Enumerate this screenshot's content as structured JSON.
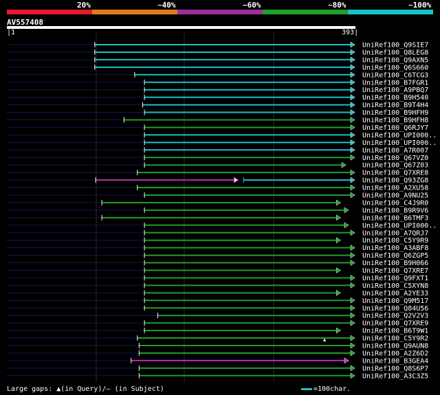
{
  "legend": {
    "labels": [
      "20%",
      "~40%",
      "~60%",
      "~80%",
      "~100%"
    ],
    "colors": [
      "#e8192c",
      "#e07a1a",
      "#9b2f9b",
      "#1f9e2a",
      "#19c1c9"
    ]
  },
  "query": {
    "title": "AV557408",
    "start": "1",
    "end": "393"
  },
  "hits": [
    {
      "label": "UniRef100_Q9SIE7",
      "start": 100,
      "end": 393,
      "color": "cyan",
      "cap": "arrow"
    },
    {
      "label": "UniRef100_Q8LEG8",
      "start": 100,
      "end": 393,
      "color": "cyan",
      "cap": "arrow"
    },
    {
      "label": "UniRef100_Q9AXN5",
      "start": 100,
      "end": 393,
      "color": "cyan",
      "cap": "arrow"
    },
    {
      "label": "UniRef100_Q6S660",
      "start": 100,
      "end": 393,
      "color": "cyan",
      "cap": "arrow"
    },
    {
      "label": "UniRef100_C6TCG3",
      "start": 145,
      "end": 393,
      "color": "cyan",
      "cap": "arrow"
    },
    {
      "label": "UniRef100_B7FGR1",
      "start": 156,
      "end": 393,
      "color": "cyan",
      "cap": "arrow"
    },
    {
      "label": "UniRef100_A9PBQ7",
      "start": 156,
      "end": 393,
      "color": "cyan",
      "cap": "arrow"
    },
    {
      "label": "UniRef100_B9H540",
      "start": 156,
      "end": 393,
      "color": "cyan",
      "cap": "arrow"
    },
    {
      "label": "UniRef100_B9T4H4",
      "start": 154,
      "end": 393,
      "color": "cyan",
      "cap": "arrow"
    },
    {
      "label": "UniRef100_B9HFH9",
      "start": 156,
      "end": 393,
      "color": "cyan",
      "cap": "arrow"
    },
    {
      "label": "UniRef100_B9HFH8",
      "start": 133,
      "end": 393,
      "color": "green",
      "cap": "arrow"
    },
    {
      "label": "UniRef100_Q6RJY7",
      "start": 156,
      "end": 393,
      "color": "green",
      "cap": "arrow"
    },
    {
      "label": "UniRef100_UPI000..",
      "start": 156,
      "end": 393,
      "color": "cyan",
      "cap": "arrow"
    },
    {
      "label": "UniRef100_UPI000..",
      "start": 156,
      "end": 393,
      "color": "cyan",
      "cap": "arrow"
    },
    {
      "label": "UniRef100_A7R007",
      "start": 156,
      "end": 393,
      "color": "cyan",
      "cap": "arrow"
    },
    {
      "label": "UniRef100_Q67VZ0",
      "start": 156,
      "end": 393,
      "color": "green",
      "cap": "arrow"
    },
    {
      "label": "UniRef100_Q67Z03",
      "start": 156,
      "end": 383,
      "color": "green",
      "cap": "arrow"
    },
    {
      "label": "UniRef100_Q7XRE8",
      "start": 148,
      "end": 393,
      "color": "green",
      "cap": "arrow"
    },
    {
      "label": "UniRef100_Q93ZG8",
      "start": 101,
      "end": 393,
      "color": "split",
      "cap": "arrow"
    },
    {
      "label": "UniRef100_A2XU58",
      "start": 148,
      "end": 393,
      "color": "green",
      "cap": "arrow"
    },
    {
      "label": "UniRef100_A9NU25",
      "start": 156,
      "end": 393,
      "color": "green",
      "cap": "arrow"
    },
    {
      "label": "UniRef100_C4J9R0",
      "start": 108,
      "end": 377,
      "color": "green",
      "cap": "arrow"
    },
    {
      "label": "UniRef100_B9R9V6",
      "start": 156,
      "end": 386,
      "color": "green",
      "cap": "arrow"
    },
    {
      "label": "UniRef100_B6TMF3",
      "start": 108,
      "end": 377,
      "color": "green",
      "cap": "arrow"
    },
    {
      "label": "UniRef100_UPI000..",
      "start": 156,
      "end": 386,
      "color": "green",
      "cap": "arrow"
    },
    {
      "label": "UniRef100_A7QRJ7",
      "start": 156,
      "end": 393,
      "color": "green",
      "cap": "arrow"
    },
    {
      "label": "UniRef100_C5Y9R9",
      "start": 156,
      "end": 377,
      "color": "green",
      "cap": "arrow"
    },
    {
      "label": "UniRef100_A3ABF8",
      "start": 156,
      "end": 393,
      "color": "green",
      "cap": "arrow"
    },
    {
      "label": "UniRef100_Q6ZGP5",
      "start": 156,
      "end": 393,
      "color": "green",
      "cap": "arrow"
    },
    {
      "label": "UniRef100_B9H066",
      "start": 156,
      "end": 393,
      "color": "green",
      "cap": "arrow"
    },
    {
      "label": "UniRef100_Q7XRE7",
      "start": 156,
      "end": 377,
      "color": "green",
      "cap": "arrow"
    },
    {
      "label": "UniRef100_Q9FXT1",
      "start": 156,
      "end": 393,
      "color": "green",
      "cap": "arrow"
    },
    {
      "label": "UniRef100_C5XYN8",
      "start": 156,
      "end": 393,
      "color": "green",
      "cap": "arrow"
    },
    {
      "label": "UniRef100_A2YE33",
      "start": 156,
      "end": 377,
      "color": "green",
      "cap": "arrow"
    },
    {
      "label": "UniRef100_Q9M517",
      "start": 156,
      "end": 393,
      "color": "green",
      "cap": "arrow"
    },
    {
      "label": "UniRef100_Q84U56",
      "start": 156,
      "end": 393,
      "color": "green",
      "cap": "arrow"
    },
    {
      "label": "UniRef100_Q2V2V3",
      "start": 171,
      "end": 393,
      "color": "green",
      "cap": "arrow"
    },
    {
      "label": "UniRef100_Q7XRE9",
      "start": 156,
      "end": 393,
      "color": "green",
      "cap": "arrow"
    },
    {
      "label": "UniRef100_B6T9W1",
      "start": 156,
      "end": 377,
      "color": "green",
      "cap": "arrow"
    },
    {
      "label": "UniRef100_C5Y9R2",
      "start": 148,
      "end": 393,
      "color": "green",
      "cap": "arrow"
    },
    {
      "label": "UniRef100_Q9AUN8",
      "start": 150,
      "end": 393,
      "color": "green",
      "cap": "arrow"
    },
    {
      "label": "UniRef100_A2Z6D2",
      "start": 150,
      "end": 393,
      "color": "green",
      "cap": "arrow"
    },
    {
      "label": "UniRef100_B3GEA4",
      "start": 141,
      "end": 386,
      "color": "magenta",
      "cap": "arrow"
    },
    {
      "label": "UniRef100_Q8S6P7",
      "start": 150,
      "end": 393,
      "color": "green",
      "cap": "arrow"
    },
    {
      "label": "UniRef100_A3C3Z5",
      "start": 150,
      "end": 393,
      "color": "green",
      "cap": "arrow"
    }
  ],
  "footer": {
    "gaps_text": "Large gaps: ▲(in Query)/– (in Subject)",
    "scale_text": "=100char."
  }
}
